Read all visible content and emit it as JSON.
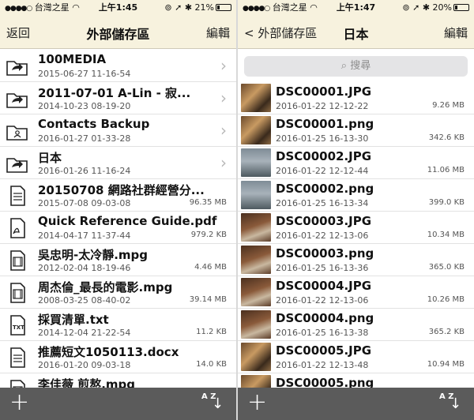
{
  "colors": {
    "navbar_bg": "#f7f2de",
    "toolbar_bg": "#5b5b5b",
    "divider": "#d8d8d8"
  },
  "left": {
    "status": {
      "carrier": "台灣之星",
      "time": "上午1:45",
      "battery": "21%",
      "battery_fraction": 0.21
    },
    "nav": {
      "back": "返回",
      "title": "外部儲存區",
      "edit": "編輯"
    },
    "items": [
      {
        "name": "100MEDIA",
        "date": "2015-06-27 11-16-54",
        "size": "",
        "icon": "folder-share-icon",
        "chevron": "›"
      },
      {
        "name": "2011-07-01 A-Lin - 寂...",
        "date": "2014-10-23 08-19-20",
        "size": "",
        "icon": "folder-share-icon",
        "chevron": "›"
      },
      {
        "name": "Contacts Backup",
        "date": "2016-01-27 01-33-28",
        "size": "",
        "icon": "folder-contacts-icon",
        "chevron": "›"
      },
      {
        "name": "日本",
        "date": "2016-01-26 11-16-24",
        "size": "",
        "icon": "folder-share-icon",
        "chevron": "›"
      },
      {
        "name": "20150708 網路社群經營分...",
        "date": "2015-07-08 09-03-08",
        "size": "96.35 MB",
        "icon": "document-icon",
        "chevron": ""
      },
      {
        "name": "Quick Reference Guide.pdf",
        "date": "2014-04-17 11-37-44",
        "size": "979.2 KB",
        "icon": "pdf-icon",
        "chevron": ""
      },
      {
        "name": "吳忠明-太冷靜.mpg",
        "date": "2012-02-04 18-19-46",
        "size": "4.46 MB",
        "icon": "video-icon",
        "chevron": ""
      },
      {
        "name": "周杰倫_最長的電影.mpg",
        "date": "2008-03-25 08-40-02",
        "size": "39.14 MB",
        "icon": "video-icon",
        "chevron": ""
      },
      {
        "name": "採買清單.txt",
        "date": "2014-12-04 21-22-54",
        "size": "11.2 KB",
        "icon": "txt-icon",
        "chevron": ""
      },
      {
        "name": "推薦短文1050113.docx",
        "date": "2016-01-20 09-03-18",
        "size": "14.0 KB",
        "icon": "document-icon",
        "chevron": ""
      },
      {
        "name": "李佳薇 煎熬.mpg",
        "date": "",
        "size": "",
        "icon": "video-icon",
        "chevron": ""
      }
    ],
    "toolbar": {
      "add": "+",
      "sort_az": "A Z",
      "sort_arrow": "↓"
    }
  },
  "right": {
    "status": {
      "carrier": "台灣之星",
      "time": "上午1:47",
      "battery": "20%",
      "battery_fraction": 0.2
    },
    "nav": {
      "back": "< 外部儲存區",
      "title": "日本",
      "edit": "編輯"
    },
    "search": {
      "placeholder": "搜尋",
      "icon": "search-icon"
    },
    "items": [
      {
        "name": "DSC00001.JPG",
        "date": "2016-01-22 12-12-22",
        "size": "9.26 MB",
        "thumb": "t1"
      },
      {
        "name": "DSC00001.png",
        "date": "2016-01-25 16-13-30",
        "size": "342.6 KB",
        "thumb": "t1"
      },
      {
        "name": "DSC00002.JPG",
        "date": "2016-01-22 12-12-44",
        "size": "11.06 MB",
        "thumb": "t2"
      },
      {
        "name": "DSC00002.png",
        "date": "2016-01-25 16-13-34",
        "size": "399.0 KB",
        "thumb": "t2"
      },
      {
        "name": "DSC00003.JPG",
        "date": "2016-01-22 12-13-06",
        "size": "10.34 MB",
        "thumb": "t3"
      },
      {
        "name": "DSC00003.png",
        "date": "2016-01-25 16-13-36",
        "size": "365.0 KB",
        "thumb": "t3"
      },
      {
        "name": "DSC00004.JPG",
        "date": "2016-01-22 12-13-06",
        "size": "10.26 MB",
        "thumb": "t3"
      },
      {
        "name": "DSC00004.png",
        "date": "2016-01-25 16-13-38",
        "size": "365.2 KB",
        "thumb": "t3"
      },
      {
        "name": "DSC00005.JPG",
        "date": "2016-01-22 12-13-48",
        "size": "10.94 MB",
        "thumb": "t1"
      },
      {
        "name": "DSC00005.png",
        "date": "",
        "size": "",
        "thumb": "t1"
      }
    ],
    "toolbar": {
      "add": "+",
      "sort_az": "A Z",
      "sort_arrow": "↓"
    }
  }
}
